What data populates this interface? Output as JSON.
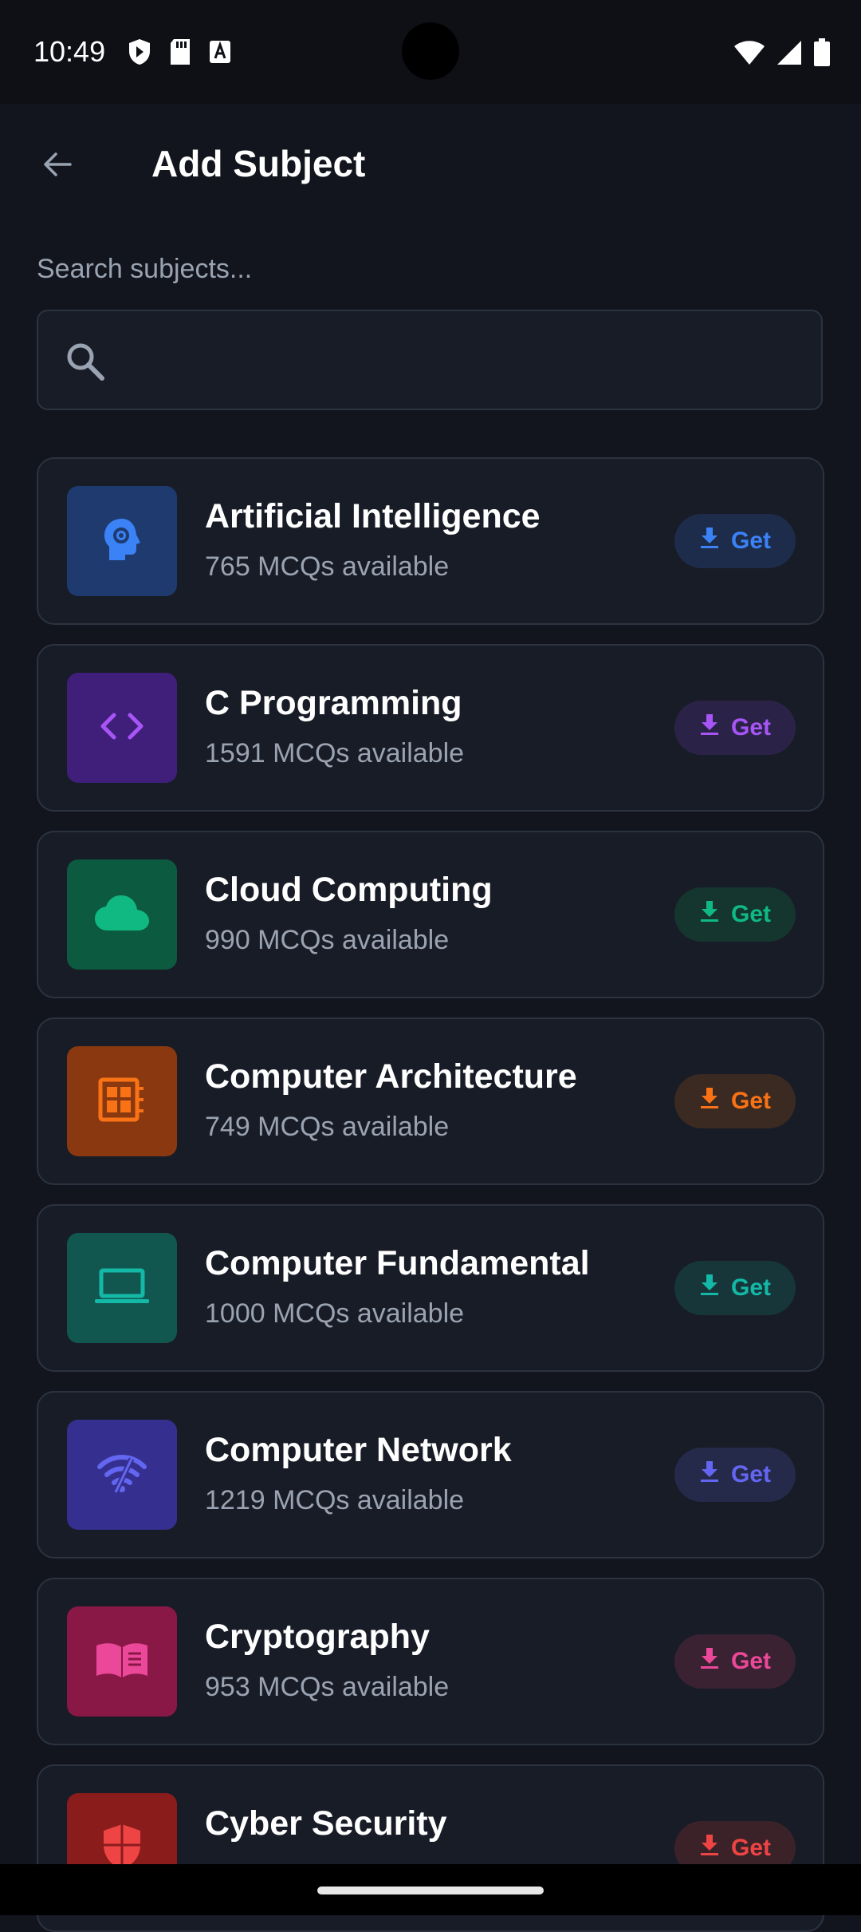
{
  "status_bar": {
    "time": "10:49"
  },
  "header": {
    "title": "Add Subject"
  },
  "search": {
    "label": "Search subjects...",
    "placeholder": ""
  },
  "subjects": [
    {
      "title": "Artificial Intelligence",
      "subtitle": "765 MCQs available",
      "action": "Get",
      "icon": "brain-gear-icon",
      "accent": "#3b82f6",
      "icon_bg": "#1e3a6e",
      "btn_bg": "#1d2c4a"
    },
    {
      "title": "C Programming",
      "subtitle": "1591 MCQs available",
      "action": "Get",
      "icon": "code-icon",
      "accent": "#a855f7",
      "icon_bg": "#3f1f7a",
      "btn_bg": "#2b2347"
    },
    {
      "title": "Cloud Computing",
      "subtitle": "990 MCQs available",
      "action": "Get",
      "icon": "cloud-icon",
      "accent": "#10b981",
      "icon_bg": "#0c5a3f",
      "btn_bg": "#15352f"
    },
    {
      "title": "Computer Architecture",
      "subtitle": "749 MCQs available",
      "action": "Get",
      "icon": "chip-icon",
      "accent": "#f97316",
      "icon_bg": "#8a3810",
      "btn_bg": "#3a2a22"
    },
    {
      "title": "Computer Fundamental",
      "subtitle": "1000 MCQs available",
      "action": "Get",
      "icon": "laptop-icon",
      "accent": "#14b8a6",
      "icon_bg": "#12574f",
      "btn_bg": "#16363a"
    },
    {
      "title": "Computer Network",
      "subtitle": "1219 MCQs available",
      "action": "Get",
      "icon": "wifi-off-icon",
      "accent": "#6366f1",
      "icon_bg": "#35308f",
      "btn_bg": "#252a4a"
    },
    {
      "title": "Cryptography",
      "subtitle": "953 MCQs available",
      "action": "Get",
      "icon": "book-icon",
      "accent": "#ec4899",
      "icon_bg": "#8a1846",
      "btn_bg": "#3a2233"
    },
    {
      "title": "Cyber Security",
      "subtitle": "",
      "action": "Get",
      "icon": "shield-icon",
      "accent": "#ef4444",
      "icon_bg": "#8a1c1c",
      "btn_bg": "#3a2228"
    }
  ]
}
